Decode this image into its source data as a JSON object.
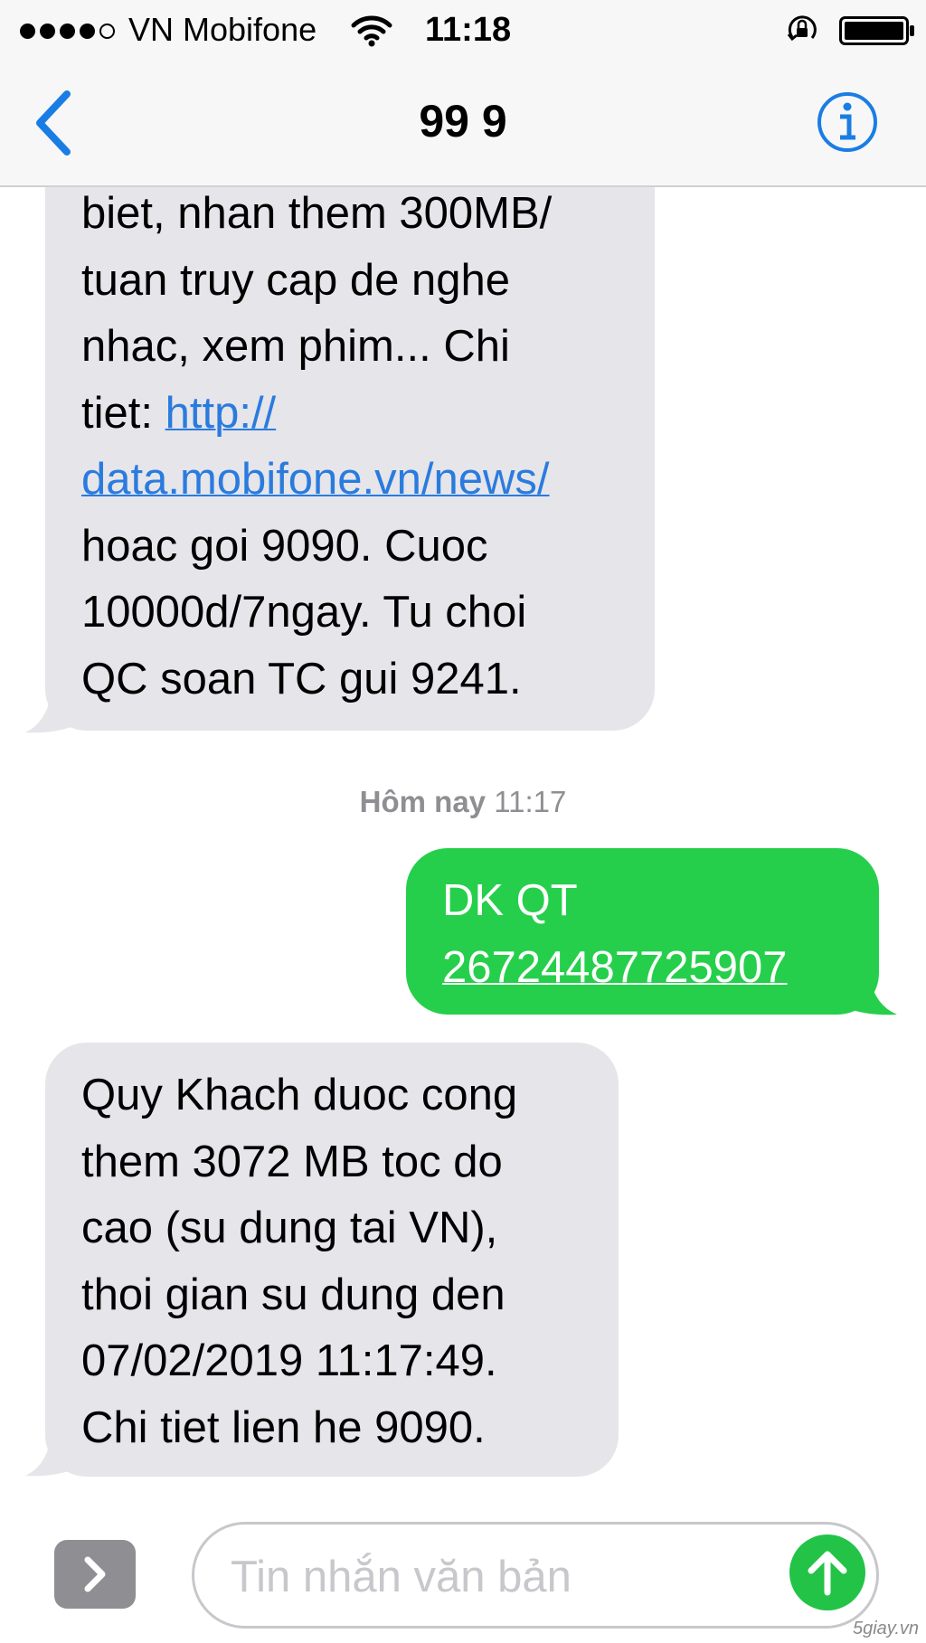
{
  "status_bar": {
    "signal_bars_filled": 4,
    "signal_bars_total": 5,
    "carrier": "VN Mobifone",
    "time": "11:18"
  },
  "nav": {
    "back_icon": "chevron-left-icon",
    "title": "99 9",
    "info_icon": "info-icon"
  },
  "messages": [
    {
      "direction": "incoming",
      "lines": [
        "biet, nhan them 300MB/",
        "tuan truy cap de nghe",
        "nhac, xem phim... Chi",
        "tiet: http://",
        "data.mobifone.vn/news/",
        "hoac goi 9090. Cuoc",
        "10000d/7ngay. Tu choi",
        "QC soan TC gui 9241."
      ],
      "line4_prefix": "tiet: ",
      "line4_link": "http://"
    },
    {
      "direction": "outgoing",
      "lines": [
        "DK QT",
        "26724487725907"
      ]
    },
    {
      "direction": "incoming",
      "lines": [
        "Quy Khach duoc cong",
        "them 3072 MB toc do",
        "cao (su dung tai VN),",
        "thoi gian su dung den",
        "07/02/2019 11:17:49.",
        "Chi tiet lien he 9090."
      ]
    }
  ],
  "timestamp": {
    "day": "Hôm nay",
    "time": "11:17"
  },
  "composer": {
    "expand_icon": "chevron-right-icon",
    "placeholder": "Tin nhắn văn bản",
    "value": "",
    "send_icon": "arrow-up-icon"
  },
  "colors": {
    "incoming_bubble": "#e5e5ea",
    "outgoing_bubble": "#26cf4b",
    "link": "#2a7bde",
    "accent": "#1a7de3"
  },
  "watermark": "5giay.vn"
}
